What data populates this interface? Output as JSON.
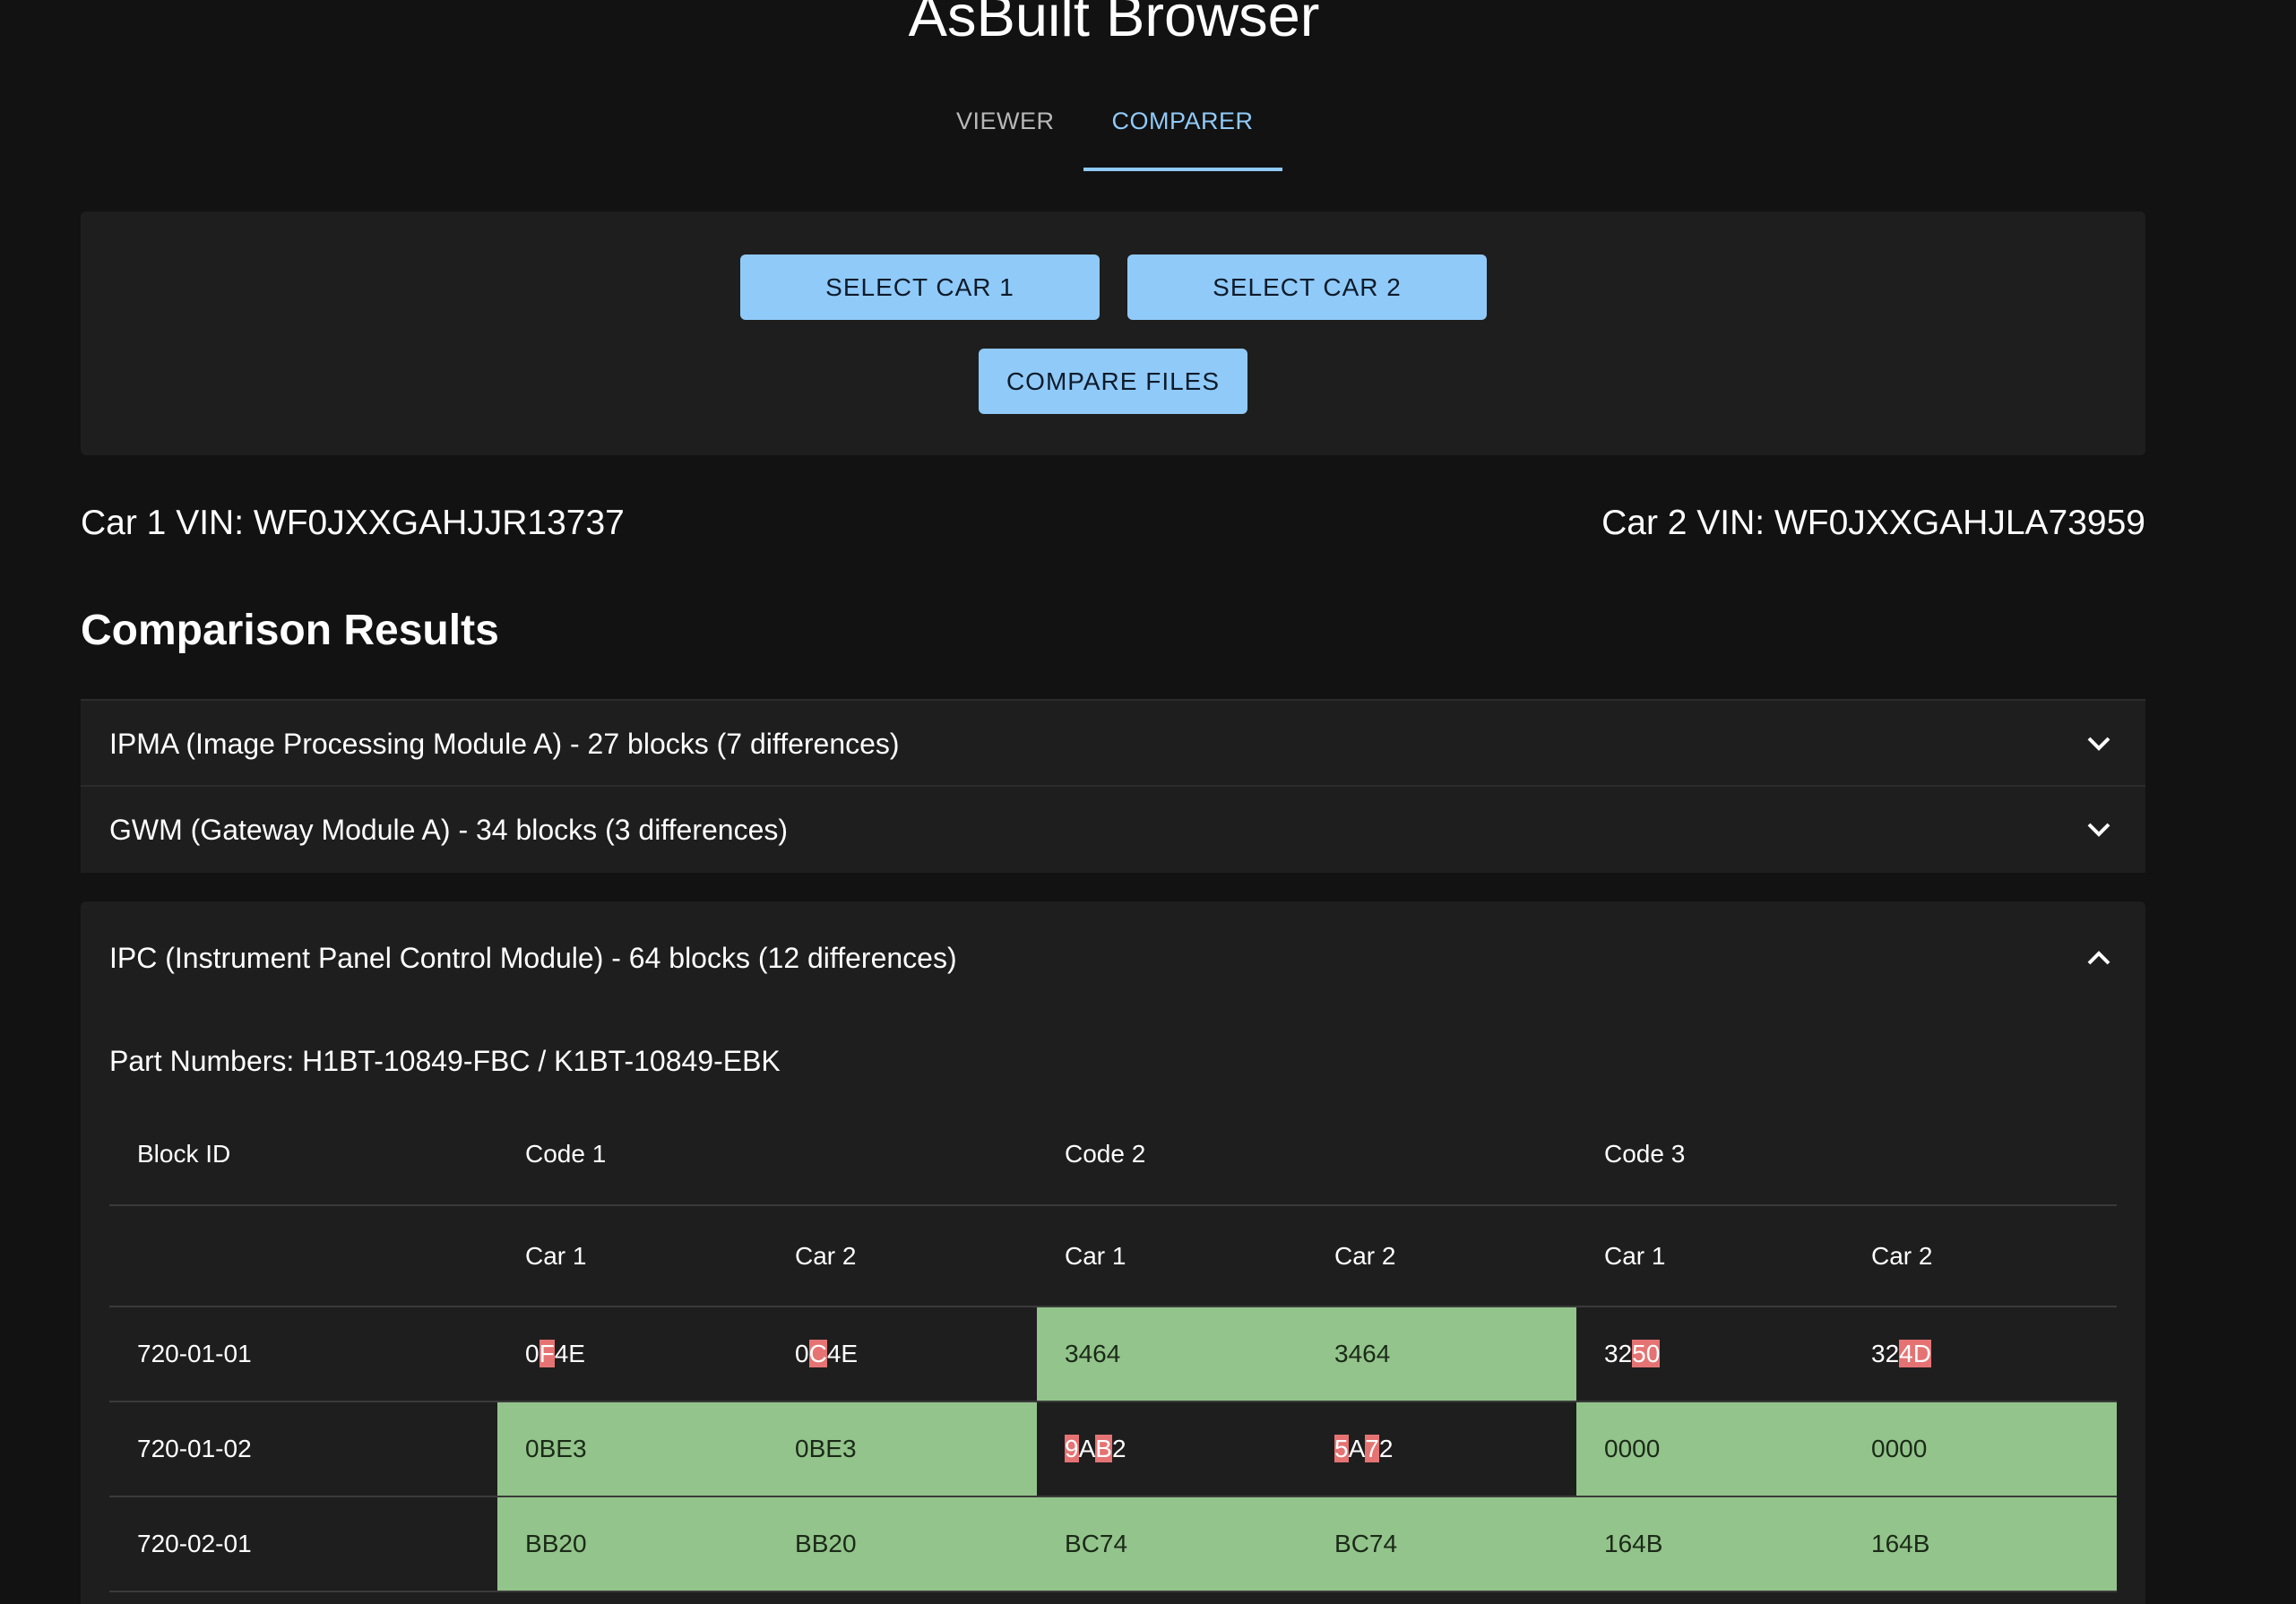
{
  "app": {
    "title": "AsBuilt Browser"
  },
  "tabs": [
    {
      "label": "VIEWER",
      "active": false
    },
    {
      "label": "COMPARER",
      "active": true
    }
  ],
  "actions": {
    "select_car_1": "SELECT CAR 1",
    "select_car_2": "SELECT CAR 2",
    "compare_files": "COMPARE FILES"
  },
  "vins": {
    "car1": "Car 1 VIN: WF0JXXGAHJJR13737",
    "car2": "Car 2 VIN: WF0JXXGAHJLA73959"
  },
  "results": {
    "heading": "Comparison Results",
    "modules": [
      {
        "label": "IPMA (Image Processing Module A) - 27 blocks (7 differences)",
        "expanded": false
      },
      {
        "label": "GWM (Gateway Module A) - 34 blocks (3 differences)",
        "expanded": false
      },
      {
        "label": "IPC (Instrument Panel Control Module) - 64 blocks (12 differences)",
        "expanded": true
      }
    ],
    "ipc": {
      "part_numbers": "Part Numbers: H1BT-10849-FBC / K1BT-10849-EBK",
      "headers": {
        "block_id": "Block ID",
        "code1": "Code 1",
        "code2": "Code 2",
        "code3": "Code 3",
        "car1": "Car 1",
        "car2": "Car 2"
      },
      "rows": [
        {
          "block": "720-01-01",
          "cells": [
            {
              "value": "0F4E",
              "match": false,
              "diff": [
                1
              ]
            },
            {
              "value": "0C4E",
              "match": false,
              "diff": [
                1
              ]
            },
            {
              "value": "3464",
              "match": true,
              "diff": []
            },
            {
              "value": "3464",
              "match": true,
              "diff": []
            },
            {
              "value": "3250",
              "match": false,
              "diff": [
                2,
                3
              ]
            },
            {
              "value": "324D",
              "match": false,
              "diff": [
                2,
                3
              ]
            }
          ]
        },
        {
          "block": "720-01-02",
          "cells": [
            {
              "value": "0BE3",
              "match": true,
              "diff": []
            },
            {
              "value": "0BE3",
              "match": true,
              "diff": []
            },
            {
              "value": "9AB2",
              "match": false,
              "diff": [
                0,
                2
              ]
            },
            {
              "value": "5A72",
              "match": false,
              "diff": [
                0,
                2
              ]
            },
            {
              "value": "0000",
              "match": true,
              "diff": []
            },
            {
              "value": "0000",
              "match": true,
              "diff": []
            }
          ]
        },
        {
          "block": "720-02-01",
          "cells": [
            {
              "value": "BB20",
              "match": true,
              "diff": []
            },
            {
              "value": "BB20",
              "match": true,
              "diff": []
            },
            {
              "value": "BC74",
              "match": true,
              "diff": []
            },
            {
              "value": "BC74",
              "match": true,
              "diff": []
            },
            {
              "value": "164B",
              "match": true,
              "diff": []
            },
            {
              "value": "164B",
              "match": true,
              "diff": []
            }
          ]
        }
      ]
    }
  },
  "colors": {
    "accent": "#90caf9",
    "match": "#93c48b",
    "diff": "#e57373",
    "background": "#121212",
    "surface": "#1e1e1e"
  },
  "icons": {
    "collapsed": "chevron-down-icon",
    "expanded": "chevron-up-icon"
  }
}
